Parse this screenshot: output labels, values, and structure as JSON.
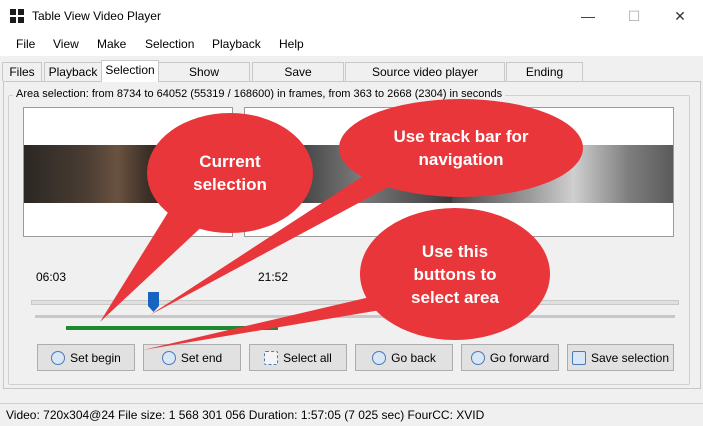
{
  "window": {
    "title": "Table View Video Player",
    "minimize": "—",
    "maximize": "☐",
    "close": "✕"
  },
  "menu": [
    "File",
    "View",
    "Make",
    "Selection",
    "Playback",
    "Help"
  ],
  "tabs": [
    "Files",
    "Playback",
    "Selection",
    "Show parameters",
    "Save parameters",
    "Source video player parameters",
    "Ending frames"
  ],
  "active_tab": "Selection",
  "area_selection_text": "Area selection: from 8734 to 64052 (55319 / 168600) in frames, from 363 to 2668 (2304) in seconds",
  "frames": [
    {
      "time": "06:03"
    },
    {
      "time": "21:52"
    }
  ],
  "buttons": [
    "Set begin",
    "Set end",
    "Select all",
    "Go back",
    "Go forward",
    "Save selection"
  ],
  "status": "Video: 720x304@24  File size: 1 568 301 056  Duration: 1:57:05 (7 025 sec)  FourCC: XVID",
  "callouts": {
    "current": "Current selection",
    "trackbar": "Use track bar for navigation",
    "buttons": "Use this buttons to select area"
  },
  "colors": {
    "callout": "#e8363b",
    "selection_bar": "#1e8a2f",
    "thumb": "#1565c0"
  }
}
